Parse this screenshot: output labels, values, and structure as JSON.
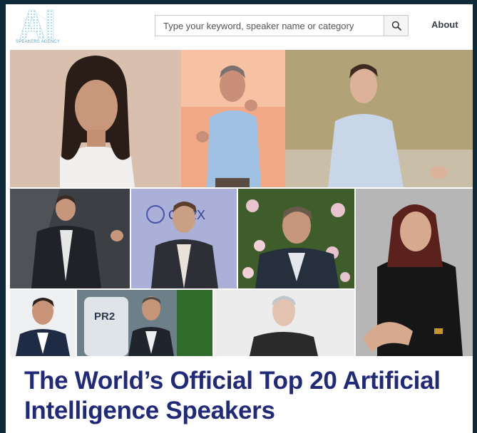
{
  "header": {
    "logo_text": "AI",
    "logo_subtext": "SPEAKERS AGENCY",
    "search": {
      "placeholder": "Type your keyword, speaker name or category"
    },
    "search_icon": "search-icon",
    "nav": {
      "about_label": "About"
    }
  },
  "collage": {
    "tile_labels": [
      "CORX",
      "PR2"
    ]
  },
  "main": {
    "headline": "The World’s Official Top 20 Artificial Intelligence Speakers"
  },
  "colors": {
    "headline": "#212a78",
    "frame": "#0f2a38",
    "logo": "#5aa6c8"
  }
}
